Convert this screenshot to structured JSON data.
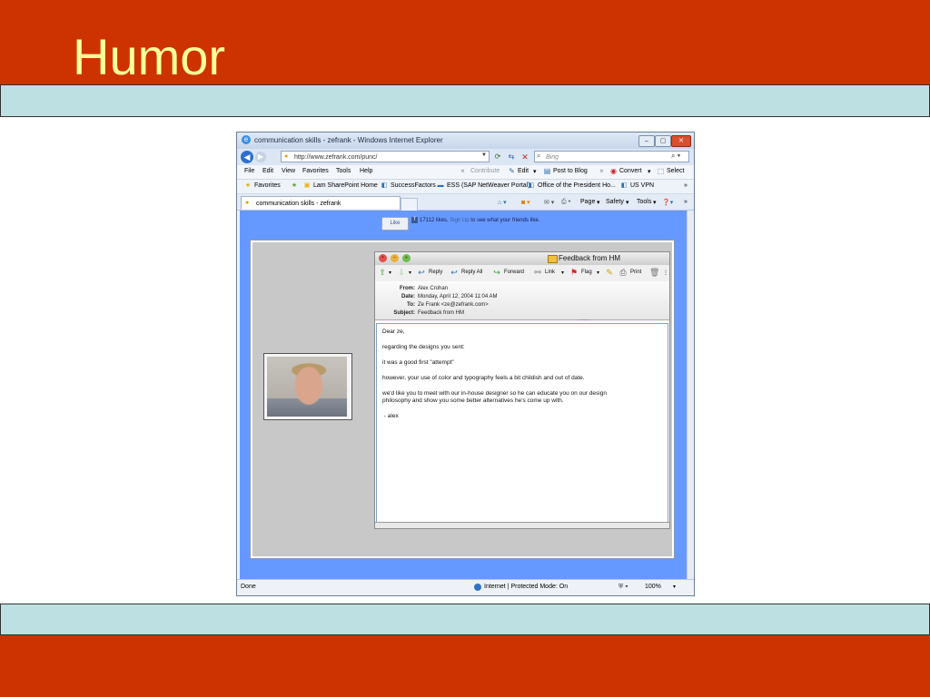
{
  "slide": {
    "title": "Humor",
    "colors": {
      "title_bar": "#cc3300",
      "title_text": "#ffff99",
      "band": "#bde0e3"
    }
  },
  "browser": {
    "window_title": "communication skills - zefrank - Windows Internet Explorer",
    "address": "http://www.zefrank.com/punc/",
    "search_placeholder": "Bing",
    "menu": [
      "File",
      "Edit",
      "View",
      "Favorites",
      "Tools",
      "Help"
    ],
    "toolbar": {
      "contribute": "Contribute",
      "edit": "Edit",
      "post_to_blog": "Post to Blog",
      "convert": "Convert",
      "select": "Select"
    },
    "favorites_label": "Favorites",
    "favorites": [
      "Lam SharePoint Home",
      "SuccessFactors",
      "ESS (SAP NetWeaver Portal)",
      "Office of the President Ho...",
      "US VPN"
    ],
    "tab_title": "communication skills - zefrank",
    "command_bar": {
      "page": "Page",
      "safety": "Safety",
      "tools": "Tools"
    },
    "status": {
      "text": "Done",
      "zone": "Internet | Protected Mode: On",
      "zoom": "100%"
    }
  },
  "page": {
    "like_button": "Like",
    "like_count_text": "17112 likes.",
    "like_signup_link": "Sign Up",
    "like_tail_text": "to see what your friends like.",
    "mail": {
      "window_title": "Feedback from HM",
      "toolbar": [
        "Reply",
        "Reply All",
        "Forward",
        "Link",
        "Flag",
        "Print"
      ],
      "header": {
        "from_label": "From:",
        "from": "Alex Crohan",
        "date_label": "Date:",
        "date": "Monday, April 12, 2004 11:04 AM",
        "to_label": "To:",
        "to": "Ze Frank <ze@zefrank.com>",
        "subject_label": "Subject:",
        "subject": "Feedback from HM"
      },
      "body": [
        "Dear ze,",
        "regarding the designs you sent:",
        "it was a good first \"attempt\"",
        "however, your use of color and typography feels a bit childish and out of date.",
        "we'd like you to meet with our in-house designer so he can educate you on our design",
        "philosophy and show you some better alternatives he's come up with.",
        " - alex"
      ]
    }
  }
}
